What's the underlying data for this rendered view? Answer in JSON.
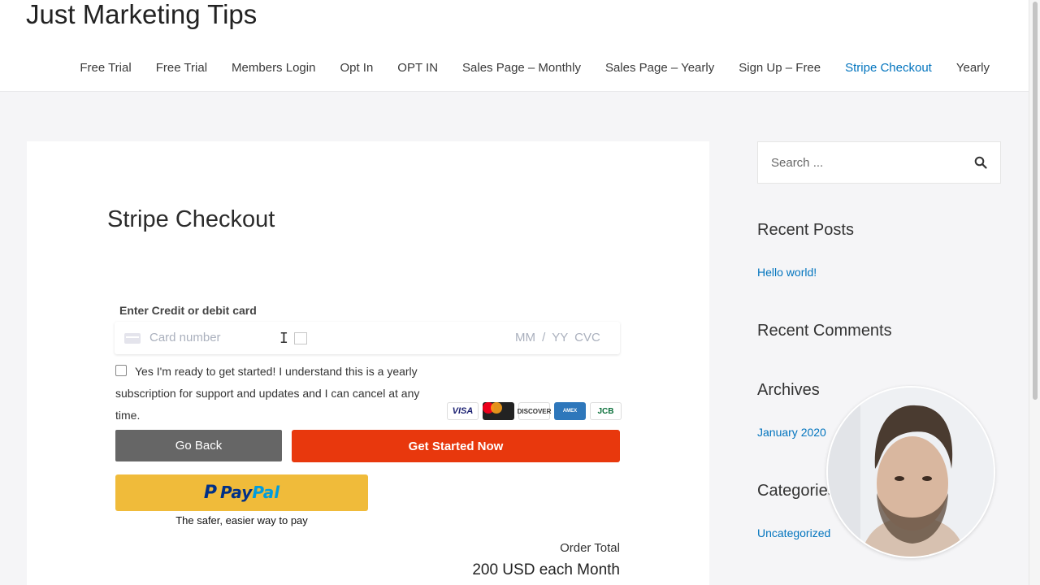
{
  "site": {
    "title": "Just Marketing Tips"
  },
  "nav": {
    "items": [
      {
        "label": "Free Trial",
        "active": false
      },
      {
        "label": "Free Trial",
        "active": false
      },
      {
        "label": "Members Login",
        "active": false
      },
      {
        "label": "Opt In",
        "active": false
      },
      {
        "label": "OPT IN",
        "active": false
      },
      {
        "label": "Sales Page – Monthly",
        "active": false
      },
      {
        "label": "Sales Page – Yearly",
        "active": false
      },
      {
        "label": "Sign Up – Free",
        "active": false
      },
      {
        "label": "Stripe Checkout",
        "active": true
      },
      {
        "label": "Yearly",
        "active": false
      }
    ]
  },
  "page": {
    "title": "Stripe Checkout"
  },
  "checkout": {
    "card_label": "Enter Credit or debit card",
    "card_number_placeholder": "Card number",
    "expiry_cvc_placeholder": "MM / YY  CVC",
    "consent_text": "Yes I'm ready to get started! I understand this is a yearly subscription for support and updates and I can cancel at any time.",
    "consent_checked": false,
    "card_brands": [
      "VISA",
      "MasterCard",
      "DISCOVER",
      "AMERICAN EXPRESS",
      "JCB"
    ],
    "back_button": "Go Back",
    "submit_button": "Get Started Now",
    "paypal": {
      "logo_pay": "Pay",
      "logo_pal": "Pal",
      "tagline": "The safer, easier way to pay"
    },
    "order_total_label": "Order Total",
    "order_total_value": "200 USD each Month"
  },
  "sidebar": {
    "search_placeholder": "Search ...",
    "recent_posts_title": "Recent Posts",
    "recent_posts": [
      "Hello world!"
    ],
    "recent_comments_title": "Recent Comments",
    "archives_title": "Archives",
    "archives": [
      "January 2020"
    ],
    "categories_title": "Categories",
    "categories": [
      "Uncategorized"
    ]
  },
  "colors": {
    "link": "#0274be",
    "submit_button": "#e8380d",
    "back_button": "#666666",
    "paypal_button": "#f0bb3a"
  }
}
